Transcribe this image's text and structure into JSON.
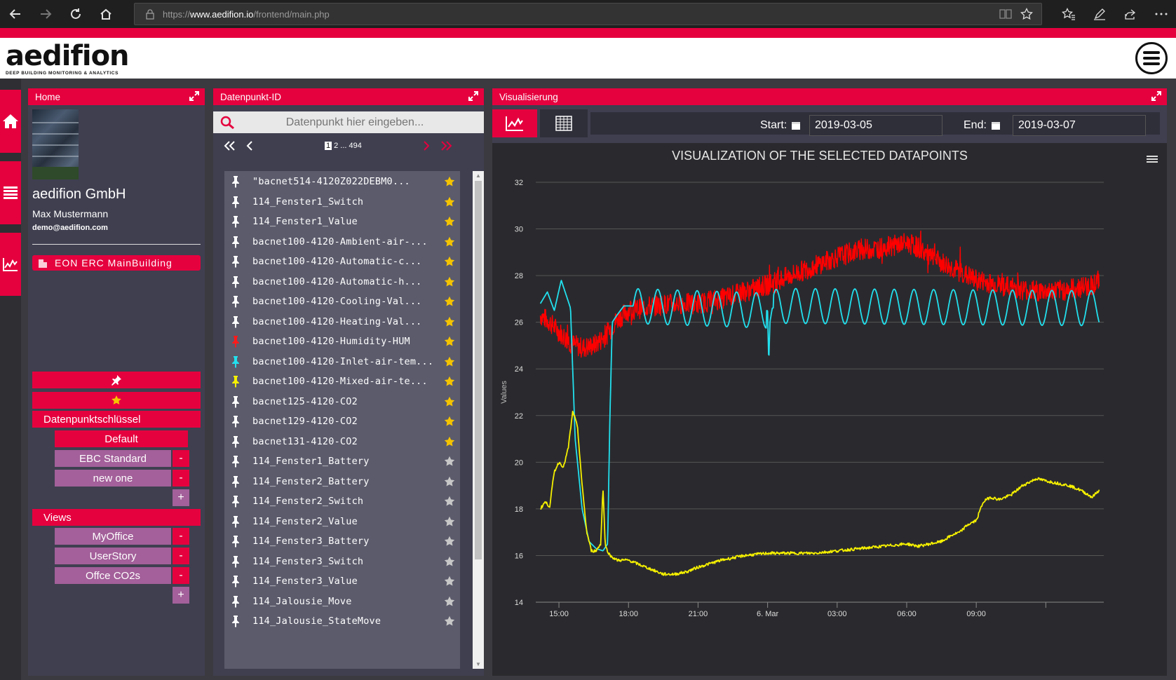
{
  "browser": {
    "url_prefix": "https://",
    "url_host": "www.aedifion.io",
    "url_path": "/frontend/main.php"
  },
  "header": {
    "logo": "aedifion",
    "tagline": "DEEP BUILDING MONITORING & ANALYTICS"
  },
  "home": {
    "title": "Home",
    "company": "aedifion GmbH",
    "user": "Max Mustermann",
    "email": "demo@aedifion.com",
    "building": "EON ERC MainBuilding",
    "keys_label": "Datenpunktschlüssel",
    "keys": [
      {
        "label": "Default",
        "removable": false
      },
      {
        "label": "EBC Standard",
        "removable": true
      },
      {
        "label": "new one",
        "removable": true
      }
    ],
    "views_label": "Views",
    "views": [
      {
        "label": "MyOffice"
      },
      {
        "label": "UserStory"
      },
      {
        "label": "Offce CO2s"
      }
    ],
    "minus": "-",
    "plus": "+"
  },
  "datapoints": {
    "title": "Datenpunkt-ID",
    "search_placeholder": "Datenpunkt hier eingeben...",
    "pager": {
      "current": "1",
      "rest": "2 ... 494"
    },
    "items": [
      {
        "name": "\"bacnet514-4120Z022DEBM0...",
        "pin": "#ffffff",
        "fav": true
      },
      {
        "name": "114_Fenster1_Switch",
        "pin": "#ffffff",
        "fav": true
      },
      {
        "name": "114_Fenster1_Value",
        "pin": "#ffffff",
        "fav": true
      },
      {
        "name": "bacnet100-4120-Ambient-air-...",
        "pin": "#ffffff",
        "fav": true
      },
      {
        "name": "bacnet100-4120-Automatic-c...",
        "pin": "#ffffff",
        "fav": true
      },
      {
        "name": "bacnet100-4120-Automatic-h...",
        "pin": "#ffffff",
        "fav": true
      },
      {
        "name": "bacnet100-4120-Cooling-Val...",
        "pin": "#ffffff",
        "fav": true
      },
      {
        "name": "bacnet100-4120-Heating-Val...",
        "pin": "#ffffff",
        "fav": true
      },
      {
        "name": "bacnet100-4120-Humidity-HUM",
        "pin": "#ff1a1a",
        "fav": true
      },
      {
        "name": "bacnet100-4120-Inlet-air-tem...",
        "pin": "#22e0ee",
        "fav": true
      },
      {
        "name": "bacnet100-4120-Mixed-air-te...",
        "pin": "#f5f000",
        "fav": true
      },
      {
        "name": "bacnet125-4120-CO2",
        "pin": "#ffffff",
        "fav": true
      },
      {
        "name": "bacnet129-4120-CO2",
        "pin": "#ffffff",
        "fav": true
      },
      {
        "name": "bacnet131-4120-CO2",
        "pin": "#ffffff",
        "fav": true
      },
      {
        "name": "114_Fenster1_Battery",
        "pin": "#ffffff",
        "fav": false
      },
      {
        "name": "114_Fenster2_Battery",
        "pin": "#ffffff",
        "fav": false
      },
      {
        "name": "114_Fenster2_Switch",
        "pin": "#ffffff",
        "fav": false
      },
      {
        "name": "114_Fenster2_Value",
        "pin": "#ffffff",
        "fav": false
      },
      {
        "name": "114_Fenster3_Battery",
        "pin": "#ffffff",
        "fav": false
      },
      {
        "name": "114_Fenster3_Switch",
        "pin": "#ffffff",
        "fav": false
      },
      {
        "name": "114_Fenster3_Value",
        "pin": "#ffffff",
        "fav": false
      },
      {
        "name": "114_Jalousie_Move",
        "pin": "#ffffff",
        "fav": false
      },
      {
        "name": "114_Jalousie_StateMove",
        "pin": "#ffffff",
        "fav": false
      }
    ]
  },
  "visual": {
    "title": "Visualisierung",
    "start_label": "Start:",
    "start_value": "2019-03-05",
    "end_label": "End:",
    "end_value": "2019-03-07"
  },
  "colors": {
    "accent": "#e5003e",
    "panel": "#3f3f50",
    "list": "#5b5b6c",
    "mauve": "#a3609a",
    "star_on": "#f5c400",
    "star_off": "#c8c8c8"
  },
  "chart_data": {
    "type": "line",
    "title": "VISUALIZATION OF THE SELECTED DATAPOINTS",
    "ylabel": "Values",
    "xlabel": "",
    "ylim": [
      14,
      32
    ],
    "yticks": [
      14,
      16,
      18,
      20,
      22,
      24,
      26,
      28,
      30,
      32
    ],
    "grid": true,
    "x_range_hours": [
      14.0,
      38.5
    ],
    "x_ticks": [
      {
        "h": 15,
        "label": "15:00"
      },
      {
        "h": 18,
        "label": "18:00"
      },
      {
        "h": 21,
        "label": "21:00"
      },
      {
        "h": 24,
        "label": "6. Mar"
      },
      {
        "h": 27,
        "label": "03:00"
      },
      {
        "h": 30,
        "label": "06:00"
      },
      {
        "h": 33,
        "label": "09:00"
      }
    ],
    "series": [
      {
        "color": "#ff0000",
        "noisy": true,
        "x": [
          14.2,
          14.6,
          15.0,
          15.5,
          16.0,
          16.5,
          17.0,
          17.5,
          18.0,
          18.5,
          19.0,
          20.0,
          21.0,
          22.0,
          23.0,
          24.0,
          25.0,
          26.0,
          27.0,
          28.0,
          29.0,
          30.0,
          30.5,
          31.0,
          32.0,
          33.0,
          34.0,
          35.0,
          36.0,
          37.0,
          38.0,
          38.3
        ],
        "y": [
          26.3,
          26.0,
          25.6,
          25.1,
          24.9,
          25.0,
          25.4,
          26.1,
          26.5,
          26.6,
          26.7,
          26.8,
          26.8,
          27.0,
          27.3,
          27.6,
          28.0,
          28.4,
          28.8,
          29.1,
          29.2,
          29.4,
          29.2,
          28.8,
          28.3,
          27.8,
          27.6,
          27.4,
          27.3,
          27.4,
          27.6,
          27.8
        ]
      },
      {
        "color": "#22e0ee",
        "x": [
          14.2,
          14.5,
          14.8,
          15.1,
          15.3,
          15.5,
          15.7,
          16.0,
          16.3,
          16.6,
          16.9,
          17.1,
          17.2,
          17.3,
          17.5,
          17.8,
          18.0,
          24.0,
          24.05,
          24.1,
          24.2,
          24.5,
          38.3
        ],
        "y": [
          26.8,
          27.3,
          26.5,
          27.8,
          27.2,
          26.6,
          21.0,
          18.0,
          16.6,
          16.3,
          16.2,
          16.5,
          22.0,
          26.0,
          26.3,
          26.7,
          26.7,
          26.5,
          24.2,
          26.0,
          26.6,
          26.7,
          26.6
        ]
      },
      {
        "color": "#f5f000",
        "x": [
          14.2,
          14.4,
          14.6,
          14.8,
          15.0,
          15.2,
          15.4,
          15.6,
          15.8,
          16.0,
          16.2,
          16.4,
          16.6,
          16.8,
          16.9,
          17.0,
          17.2,
          17.5,
          18.0,
          18.5,
          19.0,
          19.5,
          20.0,
          20.5,
          21.0,
          22.0,
          23.0,
          24.0,
          25.0,
          26.0,
          27.0,
          28.0,
          29.0,
          30.0,
          30.5,
          31.0,
          31.5,
          32.0,
          32.3,
          32.6,
          33.0,
          33.3,
          33.6,
          34.0,
          34.5,
          35.0,
          35.6,
          36.0,
          36.5,
          37.0,
          37.5,
          38.0,
          38.3
        ],
        "y": [
          18.0,
          18.3,
          18.1,
          19.6,
          20.0,
          19.8,
          20.6,
          22.2,
          21.5,
          19.0,
          17.0,
          16.2,
          16.2,
          16.5,
          18.9,
          16.4,
          16.0,
          15.8,
          15.8,
          15.6,
          15.4,
          15.2,
          15.2,
          15.3,
          15.5,
          15.8,
          16.0,
          16.1,
          16.1,
          16.1,
          16.2,
          16.3,
          16.4,
          16.5,
          16.4,
          16.5,
          16.6,
          16.9,
          17.0,
          17.3,
          17.5,
          18.3,
          18.5,
          18.4,
          18.6,
          19.0,
          19.3,
          19.2,
          19.1,
          19.0,
          18.8,
          18.5,
          18.8
        ]
      }
    ]
  }
}
